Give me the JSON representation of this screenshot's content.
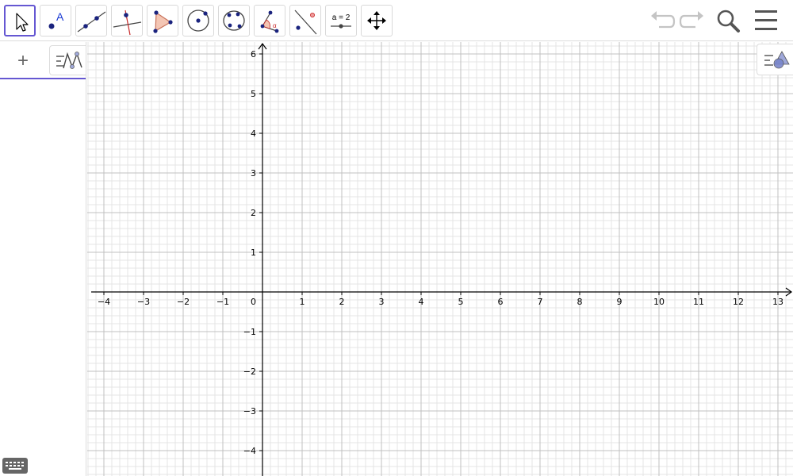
{
  "toolbar": {
    "tools": [
      {
        "name": "move-tool",
        "selected": true
      },
      {
        "name": "point-tool",
        "glyph": "A"
      },
      {
        "name": "line-tool"
      },
      {
        "name": "perpendicular-line-tool"
      },
      {
        "name": "polygon-tool"
      },
      {
        "name": "circle-with-center-tool"
      },
      {
        "name": "conic-through-points-tool"
      },
      {
        "name": "angle-tool",
        "glyph": "α"
      },
      {
        "name": "reflect-tool"
      },
      {
        "name": "slider-tool",
        "label": "a = 2"
      },
      {
        "name": "move-graphics-view-tool"
      }
    ],
    "actions": [
      "undo-icon",
      "redo-icon",
      "search-icon",
      "hamburger-menu-icon"
    ]
  },
  "algebra": {
    "add_label": "+",
    "icons": [
      "algebra-menu-icon",
      "keyboard-icon"
    ]
  },
  "graphics": {
    "x_range": [
      -4,
      13
    ],
    "y_range": [
      -4,
      6
    ],
    "origin_label": "0",
    "x_tick_labels": [
      "−4",
      "−3",
      "−2",
      "−1",
      "1",
      "2",
      "3",
      "4",
      "5",
      "6",
      "7",
      "8",
      "9",
      "10",
      "11",
      "12",
      "13"
    ],
    "y_tick_labels": [
      "6",
      "5",
      "4",
      "3",
      "2",
      "1",
      "−1",
      "−2",
      "−3",
      "−4"
    ],
    "major_grid": true,
    "minor_grid": true,
    "icons": [
      "graphics-style-bar-icon"
    ]
  },
  "colors": {
    "accent": "#6557d2",
    "point": "#1a237e",
    "polygon_fill": "#f4c6b4",
    "angle_red": "#c62828",
    "grid_major": "#c0c0c0",
    "grid_minor": "#e4e4e4",
    "axis": "#000000"
  }
}
